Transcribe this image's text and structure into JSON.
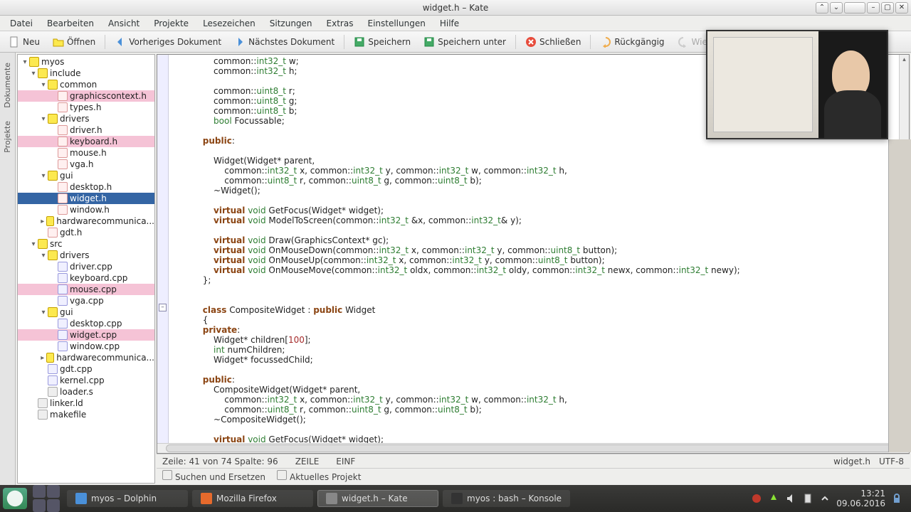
{
  "title": "widget.h – Kate",
  "menus": [
    "Datei",
    "Bearbeiten",
    "Ansicht",
    "Projekte",
    "Lesezeichen",
    "Sitzungen",
    "Extras",
    "Einstellungen",
    "Hilfe"
  ],
  "toolbar": {
    "new": "Neu",
    "open": "Öffnen",
    "prev": "Vorheriges Dokument",
    "next": "Nächstes Dokument",
    "save": "Speichern",
    "saveas": "Speichern unter",
    "close": "Schließen",
    "undo": "Rückgängig",
    "redo": "Wieder..."
  },
  "left_tabs": [
    "Dokumente",
    "Projekte"
  ],
  "tree": [
    {
      "d": 0,
      "t": "myos",
      "k": "folder",
      "exp": true
    },
    {
      "d": 1,
      "t": "include",
      "k": "folder",
      "exp": true
    },
    {
      "d": 2,
      "t": "common",
      "k": "folder",
      "exp": true
    },
    {
      "d": 3,
      "t": "graphicscontext.h",
      "k": "h",
      "open": true
    },
    {
      "d": 3,
      "t": "types.h",
      "k": "h"
    },
    {
      "d": 2,
      "t": "drivers",
      "k": "folder",
      "exp": true
    },
    {
      "d": 3,
      "t": "driver.h",
      "k": "h"
    },
    {
      "d": 3,
      "t": "keyboard.h",
      "k": "h",
      "open": true
    },
    {
      "d": 3,
      "t": "mouse.h",
      "k": "h"
    },
    {
      "d": 3,
      "t": "vga.h",
      "k": "h"
    },
    {
      "d": 2,
      "t": "gui",
      "k": "folder",
      "exp": true
    },
    {
      "d": 3,
      "t": "desktop.h",
      "k": "h"
    },
    {
      "d": 3,
      "t": "widget.h",
      "k": "h",
      "sel": true
    },
    {
      "d": 3,
      "t": "window.h",
      "k": "h"
    },
    {
      "d": 2,
      "t": "hardwarecommunica...",
      "k": "folder",
      "exp": false
    },
    {
      "d": 2,
      "t": "gdt.h",
      "k": "h"
    },
    {
      "d": 1,
      "t": "src",
      "k": "folder",
      "exp": true
    },
    {
      "d": 2,
      "t": "drivers",
      "k": "folder",
      "exp": true
    },
    {
      "d": 3,
      "t": "driver.cpp",
      "k": "c"
    },
    {
      "d": 3,
      "t": "keyboard.cpp",
      "k": "c"
    },
    {
      "d": 3,
      "t": "mouse.cpp",
      "k": "c",
      "open": true
    },
    {
      "d": 3,
      "t": "vga.cpp",
      "k": "c"
    },
    {
      "d": 2,
      "t": "gui",
      "k": "folder",
      "exp": true
    },
    {
      "d": 3,
      "t": "desktop.cpp",
      "k": "c"
    },
    {
      "d": 3,
      "t": "widget.cpp",
      "k": "c",
      "open": true
    },
    {
      "d": 3,
      "t": "window.cpp",
      "k": "c"
    },
    {
      "d": 2,
      "t": "hardwarecommunica...",
      "k": "folder",
      "exp": false
    },
    {
      "d": 2,
      "t": "gdt.cpp",
      "k": "c"
    },
    {
      "d": 2,
      "t": "kernel.cpp",
      "k": "c"
    },
    {
      "d": 2,
      "t": "loader.s",
      "k": "o"
    },
    {
      "d": 1,
      "t": "linker.ld",
      "k": "o"
    },
    {
      "d": 1,
      "t": "makefile",
      "k": "o"
    }
  ],
  "code": [
    "                common::<ty>int32_t</ty> w;",
    "                common::<ty>int32_t</ty> h;",
    "",
    "                common::<ty>uint8_t</ty> r;",
    "                common::<ty>uint8_t</ty> g;",
    "                common::<ty>uint8_t</ty> b;",
    "                <ty>bool</ty> Focussable;",
    "",
    "            <kw>public</kw>:",
    "",
    "                Widget(Widget* parent,",
    "                    common::<ty>int32_t</ty> x, common::<ty>int32_t</ty> y, common::<ty>int32_t</ty> w, common::<ty>int32_t</ty> h,",
    "                    common::<ty>uint8_t</ty> r, common::<ty>uint8_t</ty> g, common::<ty>uint8_t</ty> b);",
    "                ~Widget();",
    "",
    "                <kw>virtual</kw> <ty>void</ty> GetFocus(Widget* widget);",
    "                <kw>virtual</kw> <ty>void</ty> ModelToScreen(common::<ty>int32_t</ty> &x, common::<ty>int32_t</ty>& y);",
    "",
    "                <kw>virtual</kw> <ty>void</ty> Draw(GraphicsContext* gc);",
    "                <kw>virtual</kw> <ty>void</ty> OnMouseDown(common::<ty>int32_t</ty> x, common::<ty>int32_t</ty> y, common::<ty>uint8_t</ty> button);",
    "                <kw>virtual</kw> <ty>void</ty> OnMouseUp(common::<ty>int32_t</ty> x, common::<ty>int32_t</ty> y, common::<ty>uint8_t</ty> button);",
    "                <kw>virtual</kw> <ty>void</ty> OnMouseMove(common::<ty>int32_t</ty> oldx, common::<ty>int32_t</ty> oldy, common::<ty>int32_t</ty> newx, common::<ty>int32_t</ty> newy);",
    "            };",
    "",
    "",
    "            <kw>class</kw> CompositeWidget : <kw>public</kw> Widget",
    "            {",
    "            <kw>private</kw>:",
    "                Widget* children[<num>100</num>];",
    "                <ty>int</ty> numChildren;",
    "                Widget* focussedChild;",
    "",
    "            <kw>public</kw>:",
    "                CompositeWidget(Widget* parent,",
    "                    common::<ty>int32_t</ty> x, common::<ty>int32_t</ty> y, common::<ty>int32_t</ty> w, common::<ty>int32_t</ty> h,",
    "                    common::<ty>uint8_t</ty> r, common::<ty>uint8_t</ty> g, common::<ty>uint8_t</ty> b);",
    "                ~CompositeWidget();",
    "",
    "                <kw>virtual</kw> <ty>void</ty> GetFocus(Widget* widget);"
  ],
  "status": {
    "pos": "Zeile: 41 von 74 Spalte: 96",
    "mode": "ZEILE",
    "ins": "EINF",
    "file": "widget.h",
    "enc": "UTF-8",
    "search": "Suchen und Ersetzen",
    "proj": "Aktuelles Projekt"
  },
  "taskbar": {
    "tasks": [
      {
        "label": "myos – Dolphin",
        "color": "#4a90d9"
      },
      {
        "label": "Mozilla Firefox",
        "color": "#e66a2c"
      },
      {
        "label": "widget.h – Kate",
        "color": "#888",
        "active": true
      },
      {
        "label": "myos : bash – Konsole",
        "color": "#333"
      }
    ],
    "time": "13:21",
    "date": "09.06.2016"
  }
}
